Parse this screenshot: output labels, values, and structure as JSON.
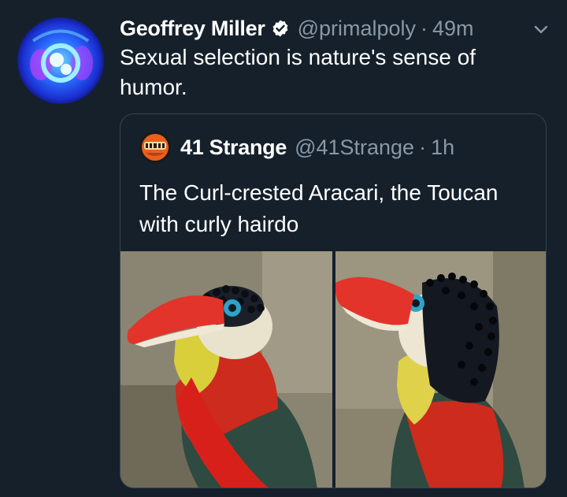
{
  "tweet": {
    "display_name": "Geoffrey Miller",
    "handle": "@primalpoly",
    "separator": "·",
    "time": "49m",
    "text": "Sexual selection is nature's sense of humor.",
    "verified": true
  },
  "quoted_tweet": {
    "display_name": "41 Strange",
    "handle": "@41Strange",
    "separator": "·",
    "time": "1h",
    "text": "The Curl-crested Aracari, the Toucan with curly hairdo",
    "media": [
      {
        "icon": "curl-crested-aracari-photo-left"
      },
      {
        "icon": "curl-crested-aracari-photo-right"
      }
    ]
  },
  "colors": {
    "background": "#15202b",
    "secondary_text": "#8899a6",
    "border": "#38444d",
    "verified_badge": "#ffffff"
  }
}
